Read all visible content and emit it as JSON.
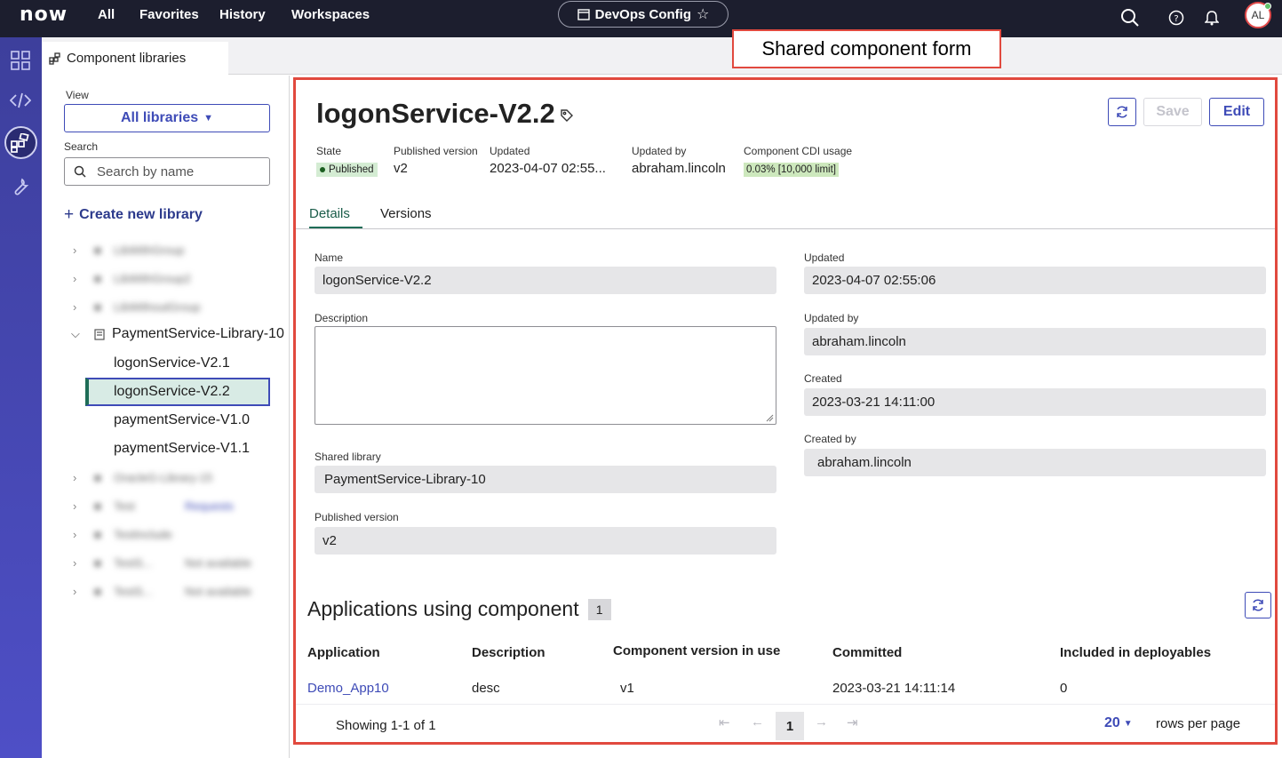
{
  "topbar": {
    "logo": "now",
    "nav": [
      "All",
      "Favorites",
      "History",
      "Workspaces"
    ],
    "workspace_pill": "DevOps Config",
    "avatar_initials": "AL"
  },
  "tab": {
    "label": "Component libraries"
  },
  "annotation": "Shared component form",
  "sidebar": {
    "view_label": "View",
    "view_value": "All libraries",
    "search_label": "Search",
    "search_placeholder": "Search by name",
    "create_label": "Create new library",
    "blurred": [
      "LibWithGroup",
      "LibWithGroup2",
      "LibWithoutGroup",
      "OracleG-Library-15",
      "Test",
      "TestInclude",
      "TestS...",
      "TestS..."
    ],
    "blurred_badges": [
      "Requests",
      "Not available",
      "Not available"
    ],
    "expanded_library": "PaymentService-Library-10",
    "children": [
      "logonService-V2.1",
      "logonService-V2.2",
      "paymentService-V1.0",
      "paymentService-V1.1"
    ]
  },
  "record": {
    "title": "logonService-V2.2",
    "save_label": "Save",
    "edit_label": "Edit",
    "meta": {
      "state_label": "State",
      "state_value": "Published",
      "pubver_label": "Published version",
      "pubver_value": "v2",
      "updated_label": "Updated",
      "updated_value": "2023-04-07 02:55...",
      "updatedby_label": "Updated by",
      "updatedby_value": "abraham.lincoln",
      "cdi_label": "Component CDI usage",
      "cdi_value": "0.03% [10,000 limit]"
    },
    "tabs": [
      "Details",
      "Versions"
    ],
    "fields": {
      "name_label": "Name",
      "name_value": "logonService-V2.2",
      "description_label": "Description",
      "shared_library_label": "Shared library",
      "shared_library_value": "PaymentService-Library-10",
      "published_version_label": "Published version",
      "published_version_value": "v2",
      "updated_label": "Updated",
      "updated_value": "2023-04-07 02:55:06",
      "updated_by_label": "Updated by",
      "updated_by_value": "abraham.lincoln",
      "created_label": "Created",
      "created_value": "2023-03-21 14:11:00",
      "created_by_label": "Created by",
      "created_by_value": "abraham.lincoln"
    }
  },
  "apps": {
    "title": "Applications using component",
    "count": "1",
    "headers": [
      "Application",
      "Description",
      "Component version in use",
      "Committed",
      "Included in deployables"
    ],
    "row": [
      "Demo_App10",
      "desc",
      "v1",
      "2023-03-21 14:11:14",
      "0"
    ],
    "showing": "Showing 1-1 of 1",
    "page": "1",
    "rows_value": "20",
    "rows_label": "rows per page"
  },
  "colors": {
    "accent": "#3e4bb7",
    "annotation": "#e1493e",
    "published": "#d4ecd3"
  }
}
